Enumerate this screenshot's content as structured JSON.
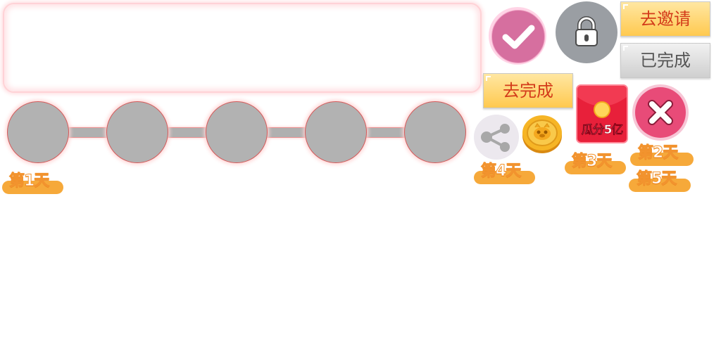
{
  "days": {
    "day1": "第1天",
    "day2": "第2天",
    "day3": "第3天",
    "day4": "第4天",
    "day5": "第5天"
  },
  "buttons": {
    "invite": "去邀请",
    "completed": "已完成",
    "go_complete": "去完成"
  },
  "red_packet": {
    "label": "瓜分5亿"
  },
  "colors": {
    "gold_button": "#ffd26a",
    "gray_button": "#dcdcdc",
    "check_circle": "#d66f9f",
    "close_circle": "#e84b78",
    "lock_circle": "#9a9ea3",
    "day_pill": "#f6a93a",
    "node_gray": "#b2b2b2"
  },
  "icons": [
    "check-icon",
    "lock-icon",
    "share-icon",
    "coin-icon",
    "red-packet-icon",
    "close-icon"
  ]
}
